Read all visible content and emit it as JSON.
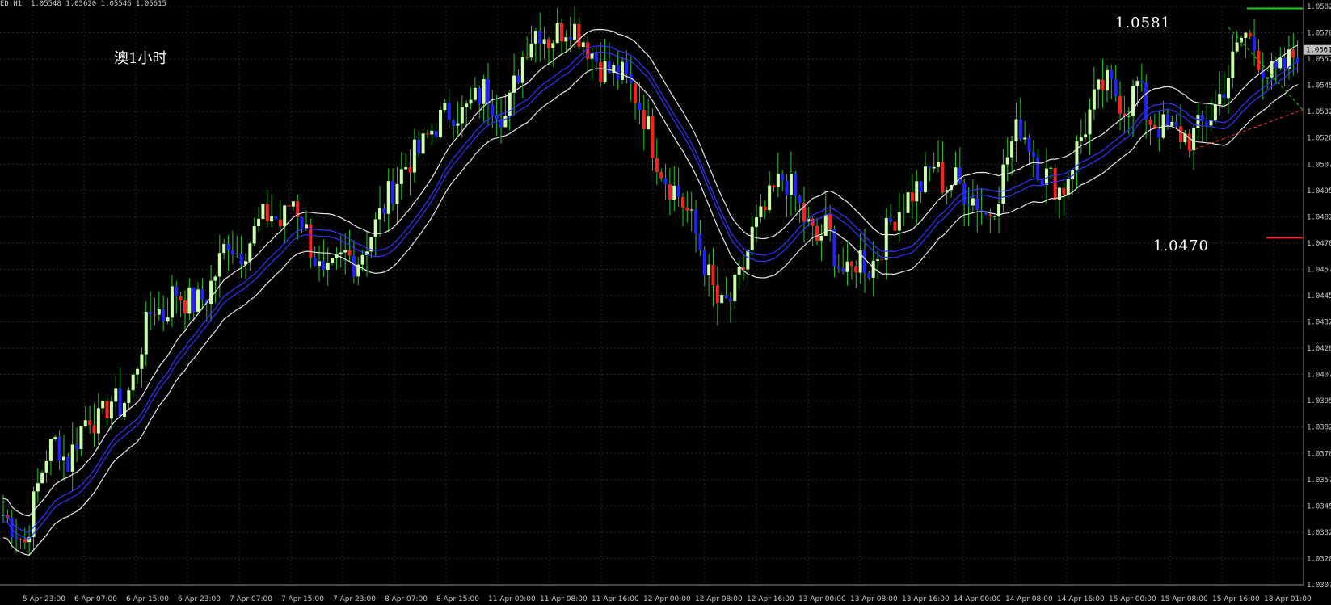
{
  "header": {
    "symbol": "ED,H1",
    "ohlc": "1.05548 1.05620 1.05546 1.05615"
  },
  "annotations": {
    "label_cn": "澳1小时",
    "level_high": "1.0581",
    "level_low": "1.0470"
  },
  "colors": {
    "background": "#000000",
    "grid": "#2a2a2a",
    "bull_candle": "#ccffaa",
    "bear_candle": "#2222ff",
    "bear_candle_alt": "#ff2020",
    "wick": "#22cc22",
    "ma_inner": "#3333ff",
    "ma_outer": "#e8e8e8",
    "level_high_line": "#22cc22",
    "level_low_line": "#ff2020",
    "current_price_box": "#c0c0c0"
  },
  "chart_data": {
    "type": "candlestick",
    "timeframe": "H1",
    "ylim": [
      1.0302,
      1.0582
    ],
    "grid": true,
    "current_price": "1.05615",
    "y_ticks": [
      "1.0582",
      "1.0570",
      "1.0557",
      "1.0545",
      "1.0532",
      "1.0520",
      "1.0507",
      "1.0495",
      "1.0482",
      "1.0470",
      "1.0457",
      "1.0445",
      "1.0432",
      "1.0420",
      "1.0407",
      "1.0395",
      "1.0382",
      "1.0370",
      "1.0357",
      "1.0345",
      "1.0332",
      "1.0320",
      "1.0307"
    ],
    "x_ticks": [
      "5 Apr 23:00",
      "6 Apr 07:00",
      "6 Apr 15:00",
      "6 Apr 23:00",
      "7 Apr 07:00",
      "7 Apr 15:00",
      "7 Apr 23:00",
      "8 Apr 07:00",
      "8 Apr 15:00",
      "11 Apr 00:00",
      "11 Apr 08:00",
      "11 Apr 16:00",
      "12 Apr 00:00",
      "12 Apr 08:00",
      "12 Apr 16:00",
      "13 Apr 00:00",
      "13 Apr 08:00",
      "13 Apr 16:00",
      "14 Apr 00:00",
      "14 Apr 08:00",
      "14 Apr 16:00",
      "15 Apr 00:00",
      "15 Apr 08:00",
      "15 Apr 16:00",
      "18 Apr 01:00"
    ],
    "price_path": [
      1.0336,
      1.033,
      1.0322,
      1.0345,
      1.0365,
      1.0372,
      1.036,
      1.0375,
      1.0385,
      1.038,
      1.0392,
      1.0388,
      1.0398,
      1.042,
      1.0438,
      1.0432,
      1.0445,
      1.044,
      1.0438,
      1.0442,
      1.0455,
      1.047,
      1.0462,
      1.0468,
      1.0478,
      1.0482,
      1.0476,
      1.049,
      1.0478,
      1.0462,
      1.0448,
      1.0455,
      1.0462,
      1.0458,
      1.0468,
      1.0478,
      1.049,
      1.05,
      1.0508,
      1.0512,
      1.0522,
      1.0528,
      1.0532,
      1.053,
      1.0536,
      1.0542,
      1.0535,
      1.0528,
      1.0548,
      1.0565,
      1.0572,
      1.0566,
      1.057,
      1.0574,
      1.0568,
      1.056,
      1.0552,
      1.055,
      1.0548,
      1.054,
      1.0528,
      1.051,
      1.0498,
      1.0492,
      1.0482,
      1.0468,
      1.045,
      1.0435,
      1.044,
      1.0452,
      1.0472,
      1.048,
      1.0492,
      1.05,
      1.049,
      1.0478,
      1.0468,
      1.0476,
      1.0458,
      1.045,
      1.0462,
      1.0455,
      1.0465,
      1.0478,
      1.0486,
      1.0492,
      1.0496,
      1.0506,
      1.0495,
      1.0498,
      1.0492,
      1.0488,
      1.048,
      1.0492,
      1.0512,
      1.0525,
      1.0515,
      1.0502,
      1.0498,
      1.0492,
      1.0508,
      1.0522,
      1.0536,
      1.0545,
      1.054,
      1.0532,
      1.0545,
      1.0528,
      1.0524,
      1.0522,
      1.052,
      1.0518,
      1.0524,
      1.053,
      1.0542,
      1.0556,
      1.057,
      1.0562,
      1.055,
      1.0548,
      1.0554,
      1.0561
    ]
  }
}
